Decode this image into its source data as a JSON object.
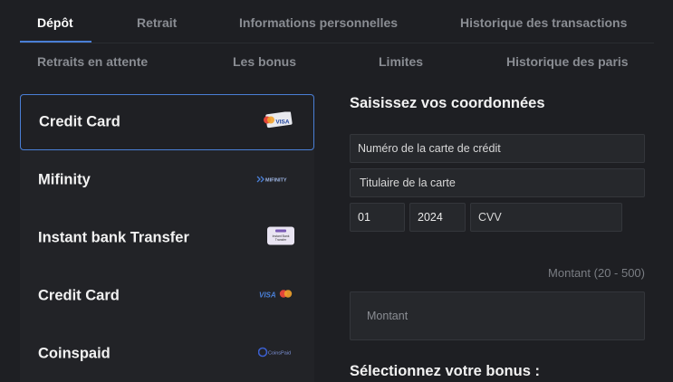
{
  "tabs_row1": [
    "Dépôt",
    "Retrait",
    "Informations personnelles",
    "Historique des transactions"
  ],
  "tabs_row2": [
    "Retraits en attente",
    "Les bonus",
    "Limites",
    "Historique des paris"
  ],
  "methods": [
    {
      "label": "Credit Card",
      "logo": "visa-card-icon",
      "logo_text": "VISA"
    },
    {
      "label": "Mifinity",
      "logo": "mifinity-logo",
      "logo_text": "MIFINITY"
    },
    {
      "label": "Instant bank Transfer",
      "logo": "instant-bank-transfer-logo",
      "logo_text": "Instant Bank Transfer"
    },
    {
      "label": "Credit Card",
      "logo": "visa-mastercard-icon",
      "logo_text": "VISA"
    },
    {
      "label": "Coinspaid",
      "logo": "coinspaid-logo",
      "logo_text": "CoinsPaid"
    }
  ],
  "form": {
    "title": "Saisissez vos coordonnées",
    "card_number_placeholder": "Numéro de la carte de crédit",
    "card_holder_placeholder": "Titulaire de la carte",
    "month_value": "01",
    "year_value": "2024",
    "cvv_placeholder": "CVV",
    "amount_hint": "Montant (20 - 500)",
    "amount_placeholder": "Montant",
    "bonus_title": "Sélectionnez votre bonus :"
  },
  "colors": {
    "background": "#1e1f23",
    "accent": "#4a7fd6",
    "field_bg": "#26282c"
  }
}
